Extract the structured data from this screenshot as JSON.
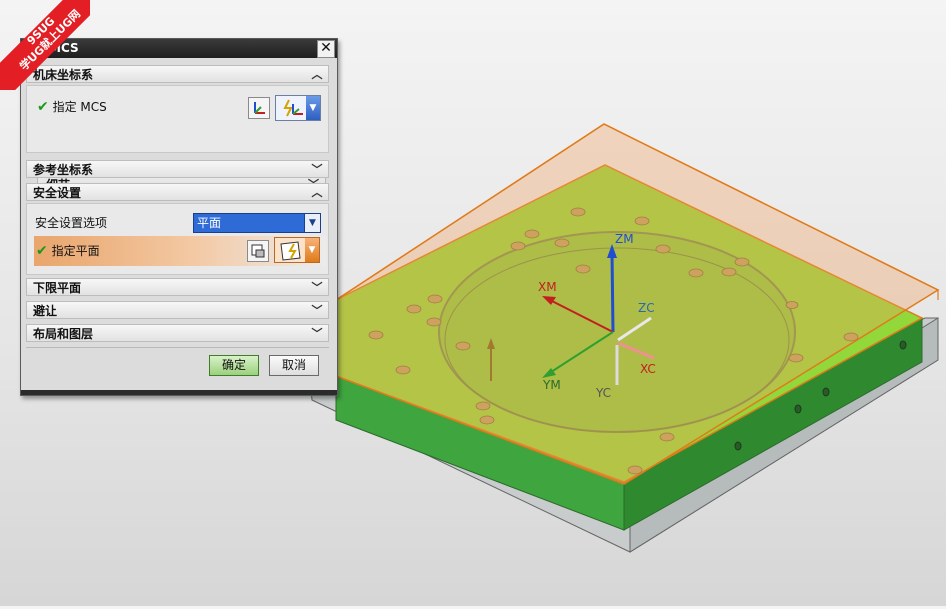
{
  "watermark": {
    "line1": "9SUG",
    "line2": "学UG就上UG网"
  },
  "dialog": {
    "title": "MCS",
    "close_label": "✕",
    "sections": {
      "machine_csys": {
        "title": "机床坐标系",
        "specify_mcs_label": "指定 MCS",
        "details_label": "细节"
      },
      "reference_csys": {
        "title": "参考坐标系"
      },
      "clearance": {
        "title": "安全设置",
        "option_label": "安全设置选项",
        "option_value": "平面",
        "specify_plane_label": "指定平面"
      },
      "lower_limit_plane": {
        "title": "下限平面"
      },
      "avoidance": {
        "title": "避让"
      },
      "layout_layers": {
        "title": "布局和图层"
      }
    },
    "ok_label": "确定",
    "cancel_label": "取消"
  },
  "axes": {
    "zm": "ZM",
    "xm": "XM",
    "ym": "YM",
    "zc": "ZC",
    "xc": "XC",
    "yc": "YC"
  },
  "colors": {
    "part_green": "#8fd63a",
    "plane_orange": "#f0a060",
    "zm_axis": "#1f4fd0",
    "xm_axis": "#c22020",
    "ym_axis": "#2fa02f",
    "accent_select": "#2e6bd6"
  }
}
